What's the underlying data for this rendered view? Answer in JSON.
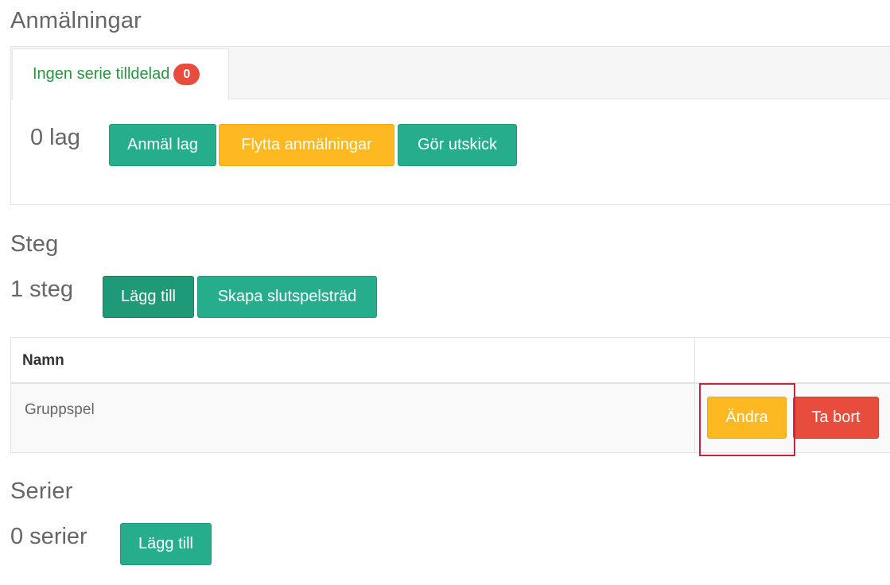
{
  "registrations": {
    "title": "Anmälningar",
    "tab": {
      "label": "Ingen serie tilldelad",
      "badge": "0"
    },
    "count_label": "0 lag",
    "buttons": {
      "register_team": "Anmäl lag",
      "move_registrations": "Flytta anmälningar",
      "send_mailing": "Gör utskick"
    }
  },
  "steps": {
    "title": "Steg",
    "count_label": "1 steg",
    "buttons": {
      "add": "Lägg till",
      "create_bracket": "Skapa slutspelsträd"
    },
    "table": {
      "header_name": "Namn",
      "rows": [
        {
          "name": "Gruppspel",
          "edit_label": "Ändra",
          "delete_label": "Ta bort"
        }
      ]
    }
  },
  "series": {
    "title": "Serier",
    "count_label": "0 serier",
    "buttons": {
      "add": "Lägg till"
    }
  },
  "colors": {
    "primary_green": "#26ae8c",
    "warning_yellow": "#fdb822",
    "danger_red": "#e74c3c",
    "tab_text_green": "#27963f",
    "highlight": "#c8233a"
  }
}
